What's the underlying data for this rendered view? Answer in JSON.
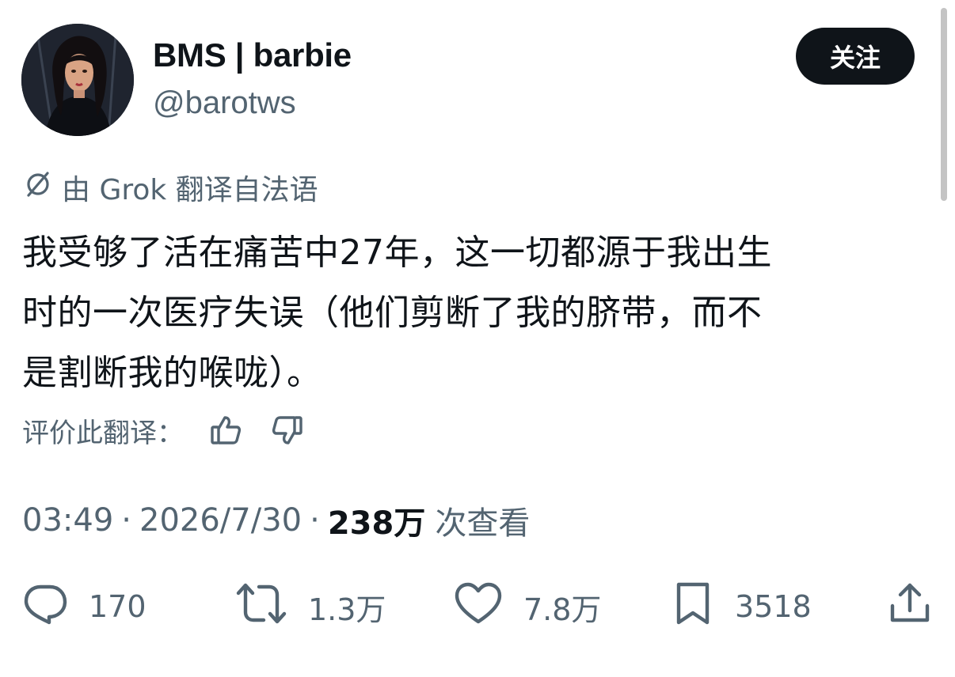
{
  "author": {
    "display_name": "BMS | barbie",
    "handle": "@barotws"
  },
  "follow_button": {
    "label": "关注"
  },
  "translation": {
    "notice": "由 Grok 翻译自法语",
    "rate_label": "评价此翻译："
  },
  "tweet": {
    "text_lines": [
      "我受够了活在痛苦中27年，这一切都源于我出生",
      "时的一次医疗失误（他们剪断了我的脐带，而不",
      "是割断我的喉咙）。"
    ]
  },
  "meta": {
    "time": "03:49",
    "date": "2026/7/30",
    "views_count": "238万",
    "views_label": "次查看",
    "separator": "·"
  },
  "actions": {
    "replies": "170",
    "reposts": "1.3万",
    "likes": "7.8万",
    "bookmarks": "3518"
  },
  "icons": {
    "translate": "grok-slash-icon",
    "thumb_up": "thumbs-up-icon",
    "thumb_down": "thumbs-down-icon",
    "reply": "reply-bubble-icon",
    "repost": "repost-icon",
    "like": "heart-icon",
    "bookmark": "bookmark-icon",
    "share": "share-icon"
  },
  "colors": {
    "text_primary": "#0f1419",
    "text_secondary": "#536471",
    "follow_button_bg": "#0f1419"
  }
}
